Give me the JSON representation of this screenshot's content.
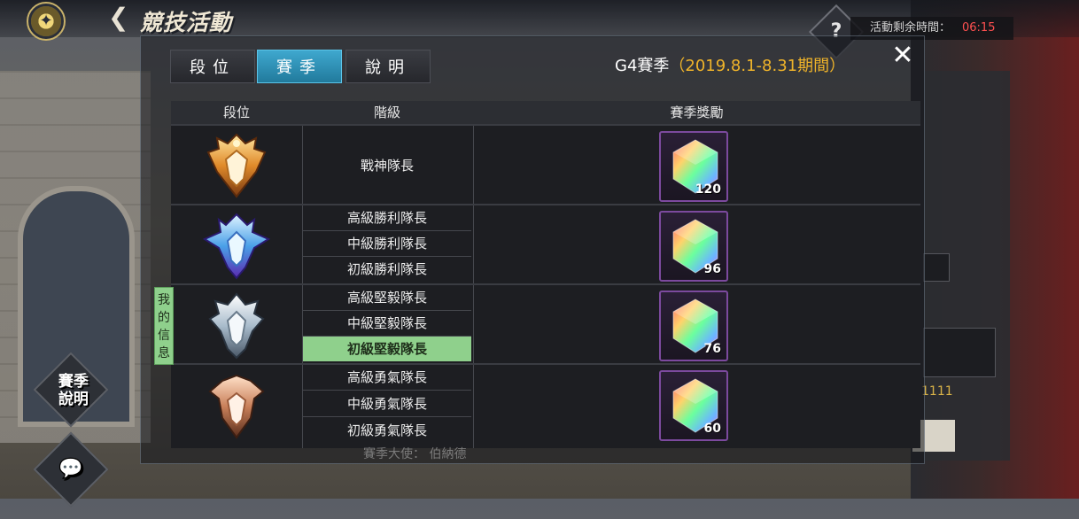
{
  "header": {
    "title": "競技活動",
    "timer_label": "活動剩余時間：",
    "timer_value": "06:15",
    "help_symbol": "?"
  },
  "tabs": [
    {
      "label": "段位",
      "active": false
    },
    {
      "label": "賽季",
      "active": true
    },
    {
      "label": "說明",
      "active": false
    }
  ],
  "season": {
    "name": "G4賽季",
    "period": "（2019.8.1-8.31期間）"
  },
  "table": {
    "headers": [
      "段位",
      "階級",
      "賽季獎勵"
    ],
    "groups": [
      {
        "badge": "gold-crown-badge",
        "tiers": [
          "戰神隊長"
        ],
        "reward_qty": "120"
      },
      {
        "badge": "blue-winged-badge",
        "tiers": [
          "高級勝利隊長",
          "中級勝利隊長",
          "初級勝利隊長"
        ],
        "reward_qty": "96"
      },
      {
        "badge": "silver-badge",
        "tiers": [
          "高級堅毅隊長",
          "中級堅毅隊長",
          "初級堅毅隊長"
        ],
        "reward_qty": "76",
        "highlight_tier": 2
      },
      {
        "badge": "bronze-badge",
        "tiers": [
          "高級勇氣隊長",
          "中級勇氣隊長",
          "初級勇氣隊長"
        ],
        "reward_qty": "60"
      }
    ]
  },
  "my_info_label": "我的信息",
  "side_buttons": {
    "season_info": "賽季說明",
    "chat_icon": "chat-bubble-icon"
  },
  "background": {
    "ambassador_text": "賽季大使：   伯納德",
    "gold_text": "1111"
  },
  "colors": {
    "active_tab": "#2b93bb",
    "highlight": "#8fd08c",
    "timer_value": "#ff5050",
    "season_period": "#f0b42a",
    "reward_border": "#7c4a9e"
  }
}
